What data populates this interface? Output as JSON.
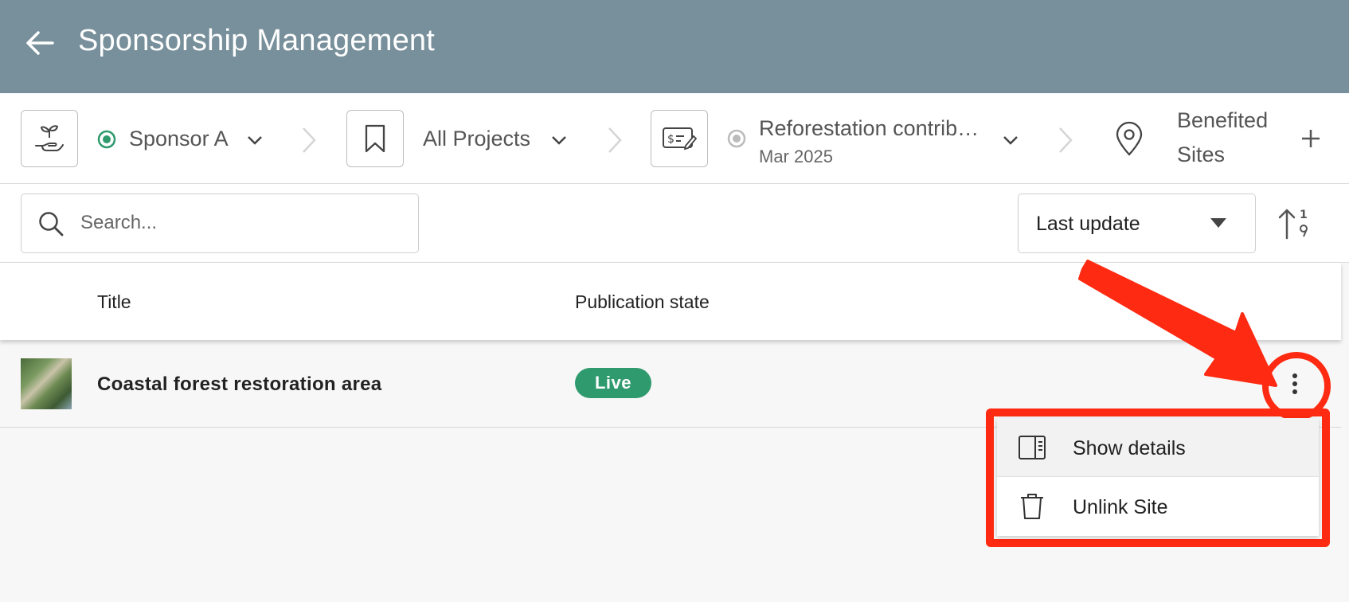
{
  "header": {
    "title": "Sponsorship Management"
  },
  "breadcrumb": {
    "sponsor": {
      "label": "Sponsor A",
      "icon": "hand-plant-icon"
    },
    "project": {
      "label": "All Projects",
      "icon": "bookmark-icon"
    },
    "contribution": {
      "label": "Reforestation contrib…",
      "sublabel": "Mar 2025",
      "icon": "check-pen-icon"
    },
    "sites": {
      "label_line1": "Benefited",
      "label_line2": "Sites",
      "icon": "location-pin-icon"
    }
  },
  "toolbar": {
    "search_placeholder": "Search...",
    "sort_label": "Last update"
  },
  "table": {
    "columns": [
      "Title",
      "Publication state"
    ],
    "rows": [
      {
        "title": "Coastal forest restoration area",
        "state": "Live"
      }
    ]
  },
  "menu": {
    "items": [
      {
        "label": "Show details",
        "icon": "side-panel-icon"
      },
      {
        "label": "Unlink Site",
        "icon": "trash-icon"
      }
    ]
  },
  "colors": {
    "header_bg": "#77909b",
    "live_badge": "#2f9a6e",
    "annotation": "#ff2a12",
    "active_dot": "#2f9a6e"
  }
}
